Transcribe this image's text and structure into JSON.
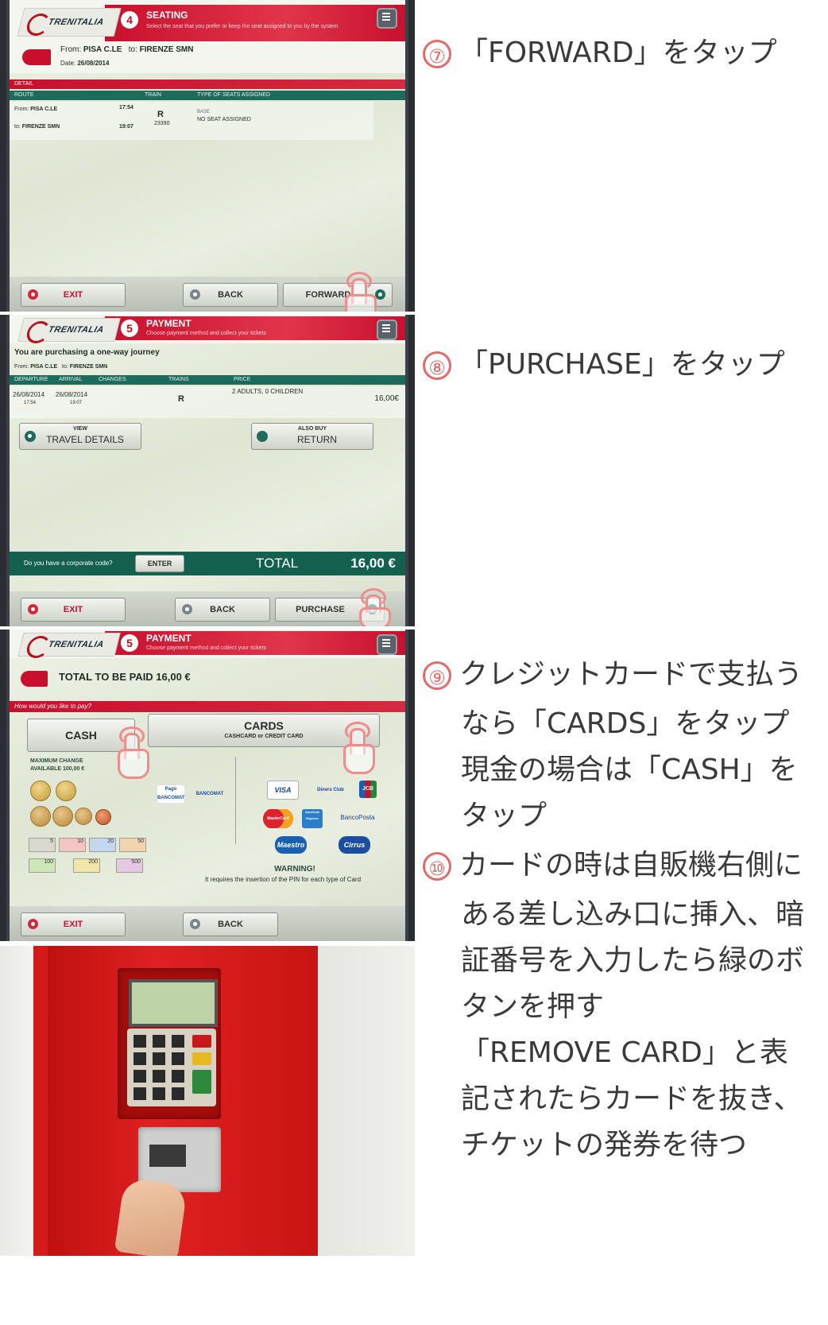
{
  "brand": "TRENITALIA",
  "screen1": {
    "step": "4",
    "title": "SEATING",
    "subtitle": "Select the seat that you prefer or keep the seat assigned to you by the system",
    "from_label": "From:",
    "from_value": "PISA C.LE",
    "to_label": "to:",
    "to_value": "FIRENZE SMN",
    "date_label": "Date:",
    "date_value": "26/08/2014",
    "section_label": "DETAIL",
    "columns": [
      "ROUTE",
      "TRAIN",
      "TYPE OF SEATS ASSIGNED"
    ],
    "row_from_label": "From:",
    "row_from_station": "PISA C.LE",
    "row_from_time": "17:54",
    "row_to_label": "to:",
    "row_to_station": "FIRENZE SMN",
    "row_to_time": "19:07",
    "train_icon": "R",
    "train_number": "23390",
    "seat_class": "BASE",
    "seat_assignment": "NO SEAT ASSIGNED",
    "exit_label": "EXIT",
    "back_label": "BACK",
    "forward_label": "FORWARD"
  },
  "screen2": {
    "step": "5",
    "title": "PAYMENT",
    "subtitle": "Choose payment method and collect your tickets",
    "journey_text": "You are purchasing a one-way journey",
    "from_label": "From:",
    "from_value": "PISA C.LE",
    "to_label": "to:",
    "to_value": "FIRENZE SMN",
    "columns": [
      "DEPARTURE",
      "ARRIVAL",
      "CHANGES",
      "TRAINS",
      "PRICE"
    ],
    "departure_date": "26/08/2014",
    "departure_time": "17:54",
    "arrival_date": "26/08/2014",
    "arrival_time": "19:07",
    "train_icon": "R",
    "passengers": "2 ADULTS, 0 CHILDREN",
    "price": "16,00€",
    "view_small": "VIEW",
    "view_label": "TRAVEL DETAILS",
    "also_small": "ALSO BUY",
    "also_label": "RETURN",
    "corporate_question": "Do you have a corporate code?",
    "enter_label": "ENTER",
    "total_label": "TOTAL",
    "total_value": "16,00 €",
    "exit_label": "EXIT",
    "back_label": "BACK",
    "purchase_label": "PURCHASE"
  },
  "screen3": {
    "step": "5",
    "title": "PAYMENT",
    "subtitle": "Choose payment method and collect your tickets",
    "total_text": "TOTAL TO BE PAID 16,00 €",
    "pay_question": "How would you like to pay?",
    "cash_label": "CASH",
    "cards_label": "CARDS",
    "cards_sub": "CASHCARD or CREDIT CARD",
    "max_change_1": "MAXIMUM CHANGE",
    "max_change_2": "AVAILABLE 100,00 €",
    "coins": [
      "2",
      "1",
      "50",
      "20",
      "10",
      "5"
    ],
    "notes": [
      "5",
      "10",
      "20",
      "50",
      "100",
      "200",
      "500"
    ],
    "card_brands": [
      "Pago BANCOMAT",
      "BANCOMAT",
      "VISA",
      "Diners Club",
      "JCB",
      "MasterCard",
      "American Express",
      "BancoPosta",
      "Maestro",
      "Cirrus"
    ],
    "warning_title": "WARNING!",
    "warning_text": "It requires the insertion of the PIN for each type of Card",
    "exit_label": "EXIT",
    "back_label": "BACK"
  },
  "captions": {
    "c7_num": "⑦",
    "c7_text": "「FORWARD」をタップ",
    "c8_num": "⑧",
    "c8_text": "「PURCHASE」をタップ",
    "c9_num": "⑨",
    "c9_lines": [
      "クレジットカードで支払う",
      "なら「CARDS」をタップ",
      "現金の場合は「CASH」を",
      "タップ"
    ],
    "c10_num": "⑩",
    "c10_lines": [
      "カードの時は自販機右側に",
      "ある差し込み口に挿入、暗",
      "証番号を入力したら緑のボ",
      "タンを押す",
      "「REMOVE CARD」と表",
      "記されたらカードを抜き、",
      "チケットの発券を待つ"
    ]
  },
  "colors": {
    "brand_red": "#c8102e",
    "teal": "#1d6b5a",
    "hand_outline": "#f08c8c",
    "caption_number": "#e46a6a"
  }
}
